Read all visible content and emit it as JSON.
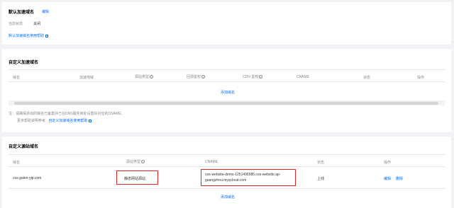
{
  "default_domain": {
    "title": "默认加速域名",
    "edit": "编辑",
    "status_label": "当前状态",
    "status_value": "关闭",
    "help_link": "默认加速域名使用帮助"
  },
  "custom_cdn": {
    "title": "自定义加速域名",
    "columns": [
      "域名",
      "加速地域",
      "源站类型",
      "回源鉴权",
      "CDN 鉴权",
      "CNAME",
      "状态",
      "操作"
    ],
    "add_link": "添加域名",
    "note_line1": "注：请确保添加的域名已备案并已在DNS服务商处设置好对应的CNAME。",
    "note_line2_prefix": "更多帮助说明参考",
    "note_line2_link": "自定义加速域名使用帮助"
  },
  "custom_origin": {
    "title": "自定义源站域名",
    "columns": [
      "域名",
      "源站类型",
      "CNAME",
      "状态",
      "操作"
    ],
    "row": {
      "domain": "cos.galen-yip.com",
      "origin_type": "静态网站源站",
      "cname_line1": "cos-website-demo-1251496585.cos-website.ap-",
      "cname_line2": "guangzhou.myqcloud.com",
      "status": "上线",
      "action_edit": "编辑",
      "action_delete": "删除"
    },
    "add_link": "添加域名"
  }
}
